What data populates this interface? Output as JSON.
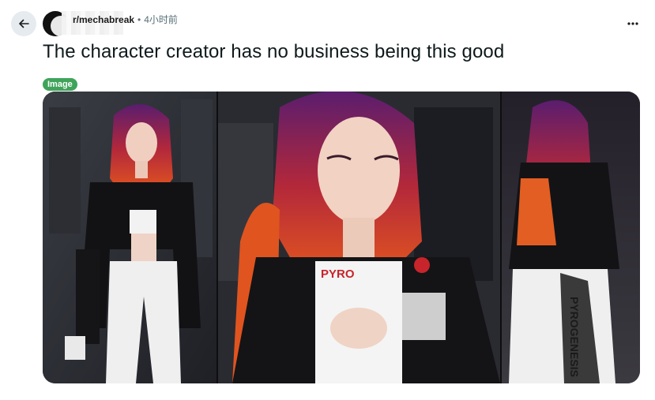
{
  "post": {
    "subreddit": "r/mechabreak",
    "separator": "•",
    "time": "4小时前",
    "title": "The character creator has no business being this good",
    "flair": "Image",
    "flair_color": "#3fa45a"
  },
  "image_text": {
    "jacket_logo": "PYRO",
    "pants_text": "PYROGENESIS"
  },
  "icons": {
    "back": "arrow-left-icon",
    "more": "more-horizontal-icon"
  },
  "colors": {
    "back_button_bg": "#e5ebee",
    "text_primary": "#0f1a1c",
    "text_muted": "#576f76"
  }
}
